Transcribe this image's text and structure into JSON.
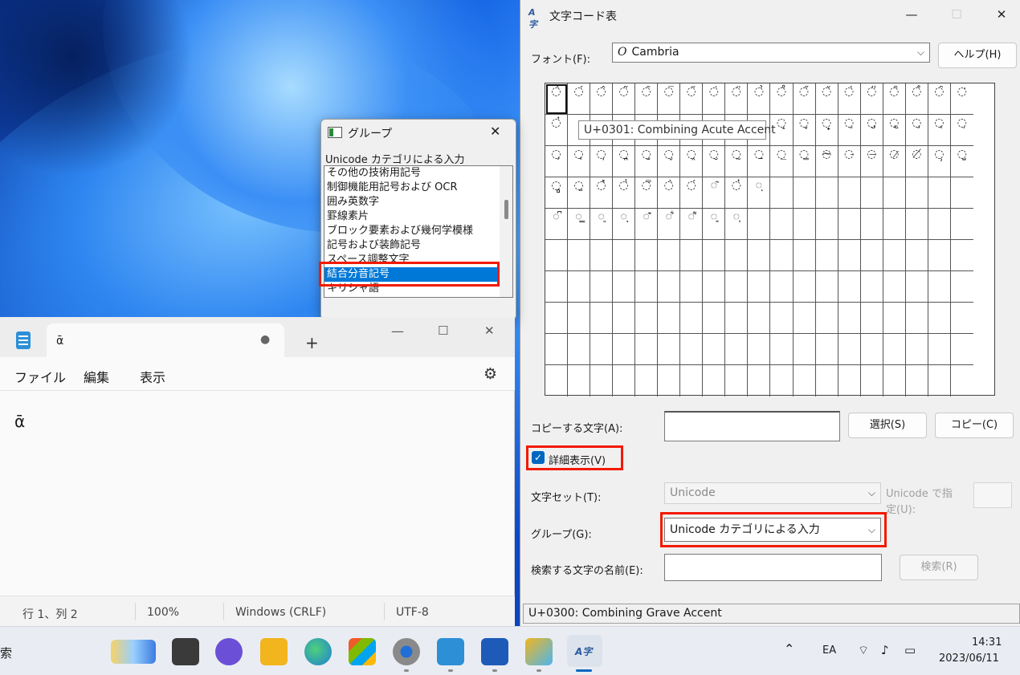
{
  "charmap": {
    "title": "文字コード表",
    "font_label": "フォント(F):",
    "font_value": "Cambria",
    "font_icon_glyph": "O",
    "help_button": "ヘルプ(H)",
    "tooltip": "U+0301: Combining Acute Accent",
    "grid_rows": [
      [
        "̀",
        "́",
        "̂",
        "̃",
        "̄",
        "̅",
        "̆",
        "̇",
        "̈",
        "̉",
        "̊",
        "̋",
        "̌",
        "̍",
        "̎",
        "̏",
        "̐",
        "̑",
        "̒"
      ],
      [
        "̓",
        "",
        "",
        "",
        "",
        "",
        "",
        "",
        "",
        "",
        "̝",
        "̞",
        "̟",
        "̠",
        "̡",
        "̢",
        "̧",
        "̨",
        "̦"
      ],
      [
        "̧",
        "̨",
        "̩",
        "̪",
        "̫",
        "̬",
        "̭",
        "̮",
        "̰",
        "̱",
        "̲",
        "̳",
        "̴",
        "̵",
        "̶",
        "̷",
        "̸",
        "̹",
        "̺"
      ],
      [
        "̻",
        "̼",
        "̽",
        "̾",
        "̿",
        "̀",
        "́",
        "͂",
        "̓",
        "ͅ",
        "",
        "",
        "",
        "",
        "",
        "",
        "",
        "",
        ""
      ],
      [
        "͆",
        "͇",
        "͈",
        "͉",
        "͊",
        "͋",
        "͌",
        "͍",
        "͎",
        "",
        "",
        "",
        "",
        "",
        "",
        "",
        "",
        "",
        ""
      ],
      [
        "",
        "",
        "",
        "",
        "",
        "",
        "",
        "",
        "",
        "",
        "",
        "",
        "",
        "",
        "",
        "",
        "",
        "",
        ""
      ],
      [
        "",
        "",
        "",
        "",
        "",
        "",
        "",
        "",
        "",
        "",
        "",
        "",
        "",
        "",
        "",
        "",
        "",
        "",
        ""
      ],
      [
        "",
        "",
        "",
        "",
        "",
        "",
        "",
        "",
        "",
        "",
        "",
        "",
        "",
        "",
        "",
        "",
        "",
        "",
        ""
      ],
      [
        "",
        "",
        "",
        "",
        "",
        "",
        "",
        "",
        "",
        "",
        "",
        "",
        "",
        "",
        "",
        "",
        "",
        "",
        ""
      ],
      [
        "",
        "",
        "",
        "",
        "",
        "",
        "",
        "",
        "",
        "",
        "",
        "",
        "",
        "",
        "",
        "",
        "",
        "",
        ""
      ]
    ],
    "copy_label": "コピーする文字(A):",
    "copy_value": "",
    "select_button": "選択(S)",
    "copy_button": "コピー(C)",
    "advanced_label": "詳細表示(V)",
    "advanced_checked": true,
    "charset_label": "文字セット(T):",
    "charset_value": "Unicode",
    "goto_label_1": "Unicode で指",
    "goto_label_2": "定(U):",
    "group_label": "グループ(G):",
    "group_value": "Unicode カテゴリによる入力",
    "search_label": "検索する文字の名前(E):",
    "search_value": "",
    "search_button": "検索(R)",
    "status": "U+0300: Combining Grave Accent"
  },
  "group_dialog": {
    "title": "グループ",
    "caption": "Unicode カテゴリによる入力",
    "items": [
      "その他の技術用記号",
      "制御機能用記号および OCR",
      "囲み英数字",
      "罫線素片",
      "ブロック要素および幾何学模様",
      "記号および装飾記号",
      "スペース調整文字",
      "結合分音記号",
      "キリシャ語"
    ],
    "selected_index": 7
  },
  "notepad": {
    "tab_title": "ᾱ",
    "menu": [
      "ファイル",
      "編集",
      "表示"
    ],
    "content": "ᾱ",
    "status": [
      "行 1、列 2",
      "100%",
      "Windows (CRLF)",
      "UTF-8"
    ]
  },
  "taskbar": {
    "search_fragment": "索",
    "ime": "EA",
    "time": "14:31",
    "date": "2023/06/11"
  },
  "colors": {
    "accent": "#0078d7",
    "highlight": "#f21a00"
  }
}
